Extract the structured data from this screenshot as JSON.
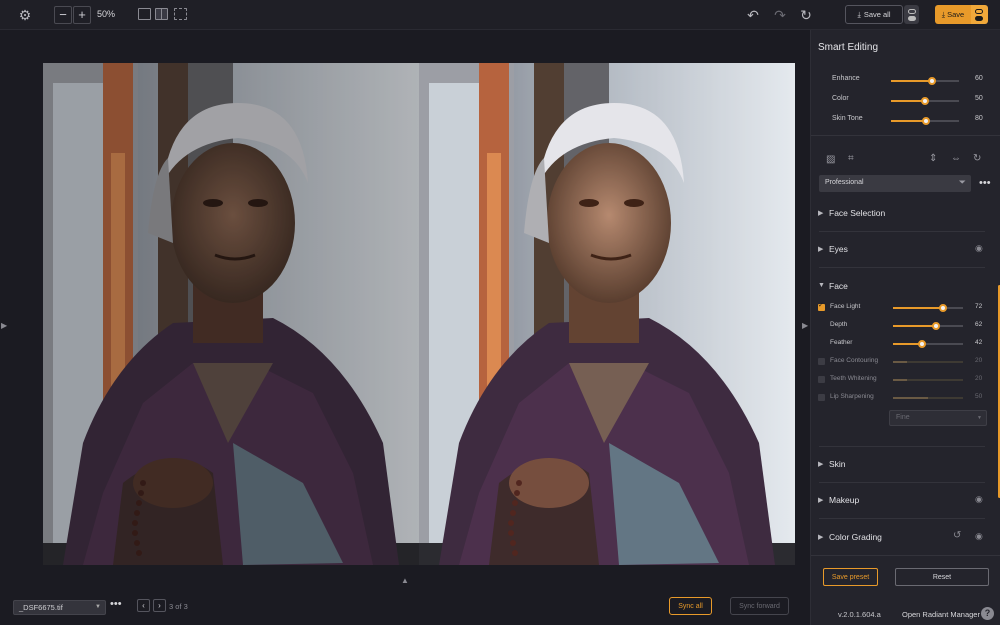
{
  "topbar": {
    "zoom": "50%",
    "save_all_label": "Save all",
    "save_label": "Save"
  },
  "bottombar": {
    "file_name": "_DSF6675.tif",
    "count": "3 of 3",
    "sync_all_label": "Sync all",
    "sync_forward_label": "Sync forward"
  },
  "panel": {
    "title": "Smart Editing",
    "sliders": [
      {
        "label": "Enhance",
        "value": 60
      },
      {
        "label": "Color",
        "value": 50
      },
      {
        "label": "Skin Tone",
        "value": 80
      }
    ],
    "preset": "Professional",
    "sections": {
      "face_selection": "Face Selection",
      "eyes": "Eyes",
      "face": "Face",
      "skin": "Skin",
      "makeup": "Makeup",
      "color_grading": "Color Grading"
    },
    "face_controls": [
      {
        "label": "Face Light",
        "value": 72,
        "checked": true
      },
      {
        "label": "Depth",
        "value": 62
      },
      {
        "label": "Feather",
        "value": 42
      },
      {
        "label": "Face Contouring",
        "value": 20,
        "checked": false
      },
      {
        "label": "Teeth Whitening",
        "value": 20,
        "checked": false
      },
      {
        "label": "Lip Sharpening",
        "value": 50,
        "checked": false
      }
    ],
    "fine_select": "Fine",
    "save_preset_label": "Save preset",
    "reset_label": "Reset",
    "version": "v.2.0.1.604.a",
    "manager_label": "Open Radiant Manager",
    "help": "?"
  },
  "colors": {
    "accent": "#e89a2a",
    "background": "#1b1b22",
    "panel": "#24242c"
  }
}
